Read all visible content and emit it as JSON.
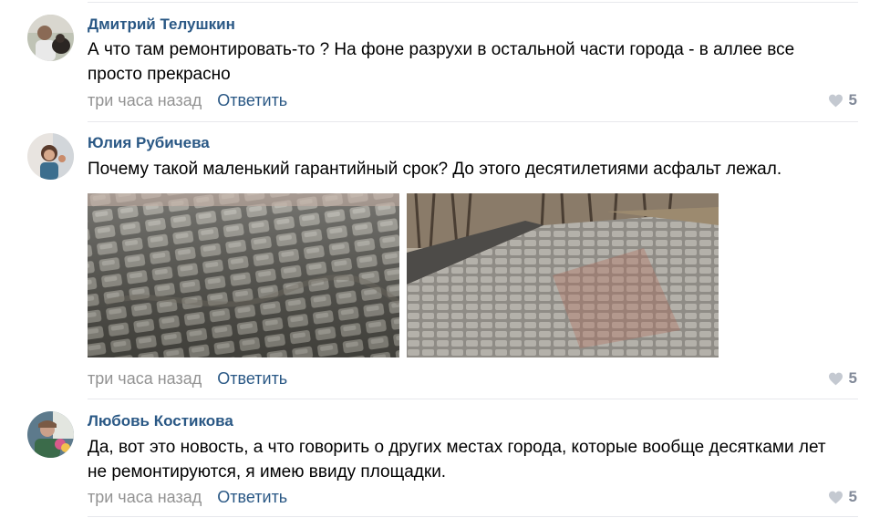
{
  "comments": [
    {
      "author": "Дмитрий Телушкин",
      "line1": "А что там ремонтировать-то ? На фоне разрухи в остальной части города - в аллее все",
      "line2": "просто прекрасно",
      "time": "три часа назад",
      "reply": "Ответить",
      "likes": "5",
      "avatar": "man-with-dog-photo"
    },
    {
      "author": "Юлия Рубичева",
      "line1": "Почему такой маленький гарантийный срок? До этого десятилетиями асфальт лежал.",
      "time": "три часа назад",
      "reply": "Ответить",
      "likes": "5",
      "avatar": "woman-photo",
      "photos": [
        {
          "alt": "damaged-paving-stones-closeup"
        },
        {
          "alt": "alley-paving-with-trees"
        }
      ]
    },
    {
      "author": "Любовь Костикова",
      "line1": "Да, вот это новость, а что говорить о других местах города, которые вообще десятками лет",
      "line2": "не ремонтируются, я имею ввиду площадки.",
      "time": "три часа назад",
      "reply": "Ответить",
      "likes": "5",
      "avatar": "woman-with-flowers-photo"
    }
  ],
  "colors": {
    "link": "#2a5885",
    "meta": "#939393",
    "like": "#828a99",
    "divider": "#e7e8ec"
  },
  "icons": {
    "like": "heart-icon"
  }
}
